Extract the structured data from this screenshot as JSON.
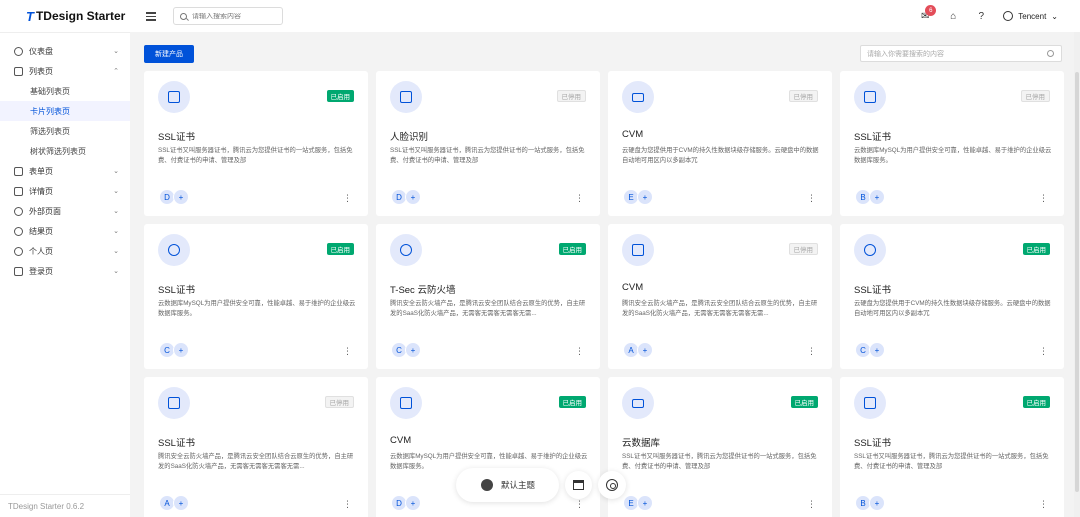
{
  "header": {
    "logo_mark": "T",
    "logo_text": "TDesign Starter",
    "search_placeholder": "请输入搜索内容",
    "notification_count": "6",
    "user_name": "Tencent"
  },
  "sidebar": {
    "items": [
      {
        "label": "仪表盘",
        "chevron": "⌄"
      },
      {
        "label": "列表页",
        "chevron": "⌃"
      },
      {
        "label": "表单页",
        "chevron": "⌄"
      },
      {
        "label": "详情页",
        "chevron": "⌄"
      },
      {
        "label": "外部页面",
        "chevron": "⌄"
      },
      {
        "label": "结果页",
        "chevron": "⌄"
      },
      {
        "label": "个人页",
        "chevron": "⌄"
      },
      {
        "label": "登录页",
        "chevron": "⌄"
      }
    ],
    "sub_items": [
      {
        "label": "基础列表页"
      },
      {
        "label": "卡片列表页"
      },
      {
        "label": "筛选列表页"
      },
      {
        "label": "树状筛选列表页"
      }
    ],
    "version": "TDesign Starter 0.6.2"
  },
  "toolbar": {
    "new_button": "新建产品",
    "search_placeholder": "请输入你需要搜索的内容"
  },
  "cards": [
    {
      "title": "SSL证书",
      "status": "已启用",
      "active": true,
      "icon": "id-card-icon",
      "desc": "SSL证书又叫服务器证书，腾讯云为您提供证书的一站式服务，包括免费、付费证书的申请、管理及部",
      "avatar": "D"
    },
    {
      "title": "人脸识别",
      "status": "已停用",
      "active": false,
      "icon": "id-card-icon",
      "desc": "SSL证书又叫服务器证书，腾讯云为您提供证书的一站式服务，包括免费、付费证书的申请、管理及部",
      "avatar": "D"
    },
    {
      "title": "CVM",
      "status": "已停用",
      "active": false,
      "icon": "laptop-icon",
      "desc": "云硬盘为您提供用于CVM的持久性数据块级存储服务。云硬盘中的数据自动地可用区内以多副本冗",
      "avatar": "E"
    },
    {
      "title": "SSL证书",
      "status": "已停用",
      "active": false,
      "icon": "calendar-icon",
      "desc": "云数据库MySQL为用户提供安全可靠，性能卓越、易于维护的企业级云数据库服务。",
      "avatar": "B"
    },
    {
      "title": "SSL证书",
      "status": "已启用",
      "active": true,
      "icon": "headset-icon",
      "desc": "云数据库MySQL为用户提供安全可靠，性能卓越、易于维护的企业级云数据库服务。",
      "avatar": "C"
    },
    {
      "title": "T-Sec 云防火墙",
      "status": "已启用",
      "active": true,
      "icon": "headset-icon",
      "desc": "腾讯安全云防火墙产品，是腾讯云安全团队结合云原生的优势，自主研发的SaaS化防火墙产品，无需客无需客无需客无需...",
      "avatar": "C"
    },
    {
      "title": "CVM",
      "status": "已停用",
      "active": false,
      "icon": "bag-icon",
      "desc": "腾讯安全云防火墙产品，是腾讯云安全团队结合云原生的优势，自主研发的SaaS化防火墙产品，无需客无需客无需客无需...",
      "avatar": "A"
    },
    {
      "title": "SSL证书",
      "status": "已启用",
      "active": true,
      "icon": "headset-icon",
      "desc": "云硬盘为您提供用于CVM的持久性数据块级存储服务。云硬盘中的数据自动地可用区内以多副本冗",
      "avatar": "C"
    },
    {
      "title": "SSL证书",
      "status": "已停用",
      "active": false,
      "icon": "bag-icon",
      "desc": "腾讯安全云防火墙产品，是腾讯云安全团队结合云原生的优势，自主研发的SaaS化防火墙产品，无需客无需客无需客无需...",
      "avatar": "A"
    },
    {
      "title": "CVM",
      "status": "已启用",
      "active": true,
      "icon": "id-card-icon",
      "desc": "云数据库MySQL为用户提供安全可靠，性能卓越、易于维护的企业级云数据库服务。",
      "avatar": "D"
    },
    {
      "title": "云数据库",
      "status": "已启用",
      "active": true,
      "icon": "laptop-icon",
      "desc": "SSL证书又叫服务器证书，腾讯云为您提供证书的一站式服务，包括免费、付费证书的申请、管理及部",
      "avatar": "E"
    },
    {
      "title": "SSL证书",
      "status": "已启用",
      "active": true,
      "icon": "calendar-icon",
      "desc": "SSL证书又叫服务器证书，腾讯云为您提供证书的一站式服务，包括免费、付费证书的申请、管理及部",
      "avatar": "B"
    }
  ],
  "float_bar": {
    "theme_label": "默认主题"
  },
  "colors": {
    "primary": "#0052d9",
    "success": "#00a870"
  }
}
